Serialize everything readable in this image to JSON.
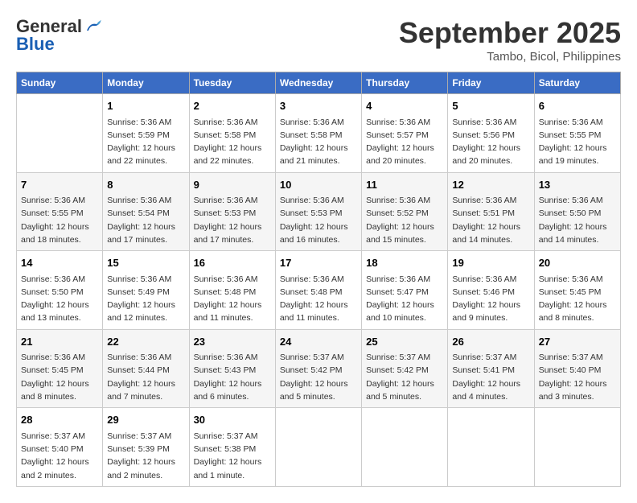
{
  "header": {
    "logo_general": "General",
    "logo_blue": "Blue",
    "month": "September 2025",
    "location": "Tambo, Bicol, Philippines"
  },
  "columns": [
    "Sunday",
    "Monday",
    "Tuesday",
    "Wednesday",
    "Thursday",
    "Friday",
    "Saturday"
  ],
  "weeks": [
    [
      {
        "day": "",
        "info": ""
      },
      {
        "day": "1",
        "info": "Sunrise: 5:36 AM\nSunset: 5:59 PM\nDaylight: 12 hours\nand 22 minutes."
      },
      {
        "day": "2",
        "info": "Sunrise: 5:36 AM\nSunset: 5:58 PM\nDaylight: 12 hours\nand 22 minutes."
      },
      {
        "day": "3",
        "info": "Sunrise: 5:36 AM\nSunset: 5:58 PM\nDaylight: 12 hours\nand 21 minutes."
      },
      {
        "day": "4",
        "info": "Sunrise: 5:36 AM\nSunset: 5:57 PM\nDaylight: 12 hours\nand 20 minutes."
      },
      {
        "day": "5",
        "info": "Sunrise: 5:36 AM\nSunset: 5:56 PM\nDaylight: 12 hours\nand 20 minutes."
      },
      {
        "day": "6",
        "info": "Sunrise: 5:36 AM\nSunset: 5:55 PM\nDaylight: 12 hours\nand 19 minutes."
      }
    ],
    [
      {
        "day": "7",
        "info": "Sunrise: 5:36 AM\nSunset: 5:55 PM\nDaylight: 12 hours\nand 18 minutes."
      },
      {
        "day": "8",
        "info": "Sunrise: 5:36 AM\nSunset: 5:54 PM\nDaylight: 12 hours\nand 17 minutes."
      },
      {
        "day": "9",
        "info": "Sunrise: 5:36 AM\nSunset: 5:53 PM\nDaylight: 12 hours\nand 17 minutes."
      },
      {
        "day": "10",
        "info": "Sunrise: 5:36 AM\nSunset: 5:53 PM\nDaylight: 12 hours\nand 16 minutes."
      },
      {
        "day": "11",
        "info": "Sunrise: 5:36 AM\nSunset: 5:52 PM\nDaylight: 12 hours\nand 15 minutes."
      },
      {
        "day": "12",
        "info": "Sunrise: 5:36 AM\nSunset: 5:51 PM\nDaylight: 12 hours\nand 14 minutes."
      },
      {
        "day": "13",
        "info": "Sunrise: 5:36 AM\nSunset: 5:50 PM\nDaylight: 12 hours\nand 14 minutes."
      }
    ],
    [
      {
        "day": "14",
        "info": "Sunrise: 5:36 AM\nSunset: 5:50 PM\nDaylight: 12 hours\nand 13 minutes."
      },
      {
        "day": "15",
        "info": "Sunrise: 5:36 AM\nSunset: 5:49 PM\nDaylight: 12 hours\nand 12 minutes."
      },
      {
        "day": "16",
        "info": "Sunrise: 5:36 AM\nSunset: 5:48 PM\nDaylight: 12 hours\nand 11 minutes."
      },
      {
        "day": "17",
        "info": "Sunrise: 5:36 AM\nSunset: 5:48 PM\nDaylight: 12 hours\nand 11 minutes."
      },
      {
        "day": "18",
        "info": "Sunrise: 5:36 AM\nSunset: 5:47 PM\nDaylight: 12 hours\nand 10 minutes."
      },
      {
        "day": "19",
        "info": "Sunrise: 5:36 AM\nSunset: 5:46 PM\nDaylight: 12 hours\nand 9 minutes."
      },
      {
        "day": "20",
        "info": "Sunrise: 5:36 AM\nSunset: 5:45 PM\nDaylight: 12 hours\nand 8 minutes."
      }
    ],
    [
      {
        "day": "21",
        "info": "Sunrise: 5:36 AM\nSunset: 5:45 PM\nDaylight: 12 hours\nand 8 minutes."
      },
      {
        "day": "22",
        "info": "Sunrise: 5:36 AM\nSunset: 5:44 PM\nDaylight: 12 hours\nand 7 minutes."
      },
      {
        "day": "23",
        "info": "Sunrise: 5:36 AM\nSunset: 5:43 PM\nDaylight: 12 hours\nand 6 minutes."
      },
      {
        "day": "24",
        "info": "Sunrise: 5:37 AM\nSunset: 5:42 PM\nDaylight: 12 hours\nand 5 minutes."
      },
      {
        "day": "25",
        "info": "Sunrise: 5:37 AM\nSunset: 5:42 PM\nDaylight: 12 hours\nand 5 minutes."
      },
      {
        "day": "26",
        "info": "Sunrise: 5:37 AM\nSunset: 5:41 PM\nDaylight: 12 hours\nand 4 minutes."
      },
      {
        "day": "27",
        "info": "Sunrise: 5:37 AM\nSunset: 5:40 PM\nDaylight: 12 hours\nand 3 minutes."
      }
    ],
    [
      {
        "day": "28",
        "info": "Sunrise: 5:37 AM\nSunset: 5:40 PM\nDaylight: 12 hours\nand 2 minutes."
      },
      {
        "day": "29",
        "info": "Sunrise: 5:37 AM\nSunset: 5:39 PM\nDaylight: 12 hours\nand 2 minutes."
      },
      {
        "day": "30",
        "info": "Sunrise: 5:37 AM\nSunset: 5:38 PM\nDaylight: 12 hours\nand 1 minute."
      },
      {
        "day": "",
        "info": ""
      },
      {
        "day": "",
        "info": ""
      },
      {
        "day": "",
        "info": ""
      },
      {
        "day": "",
        "info": ""
      }
    ]
  ]
}
